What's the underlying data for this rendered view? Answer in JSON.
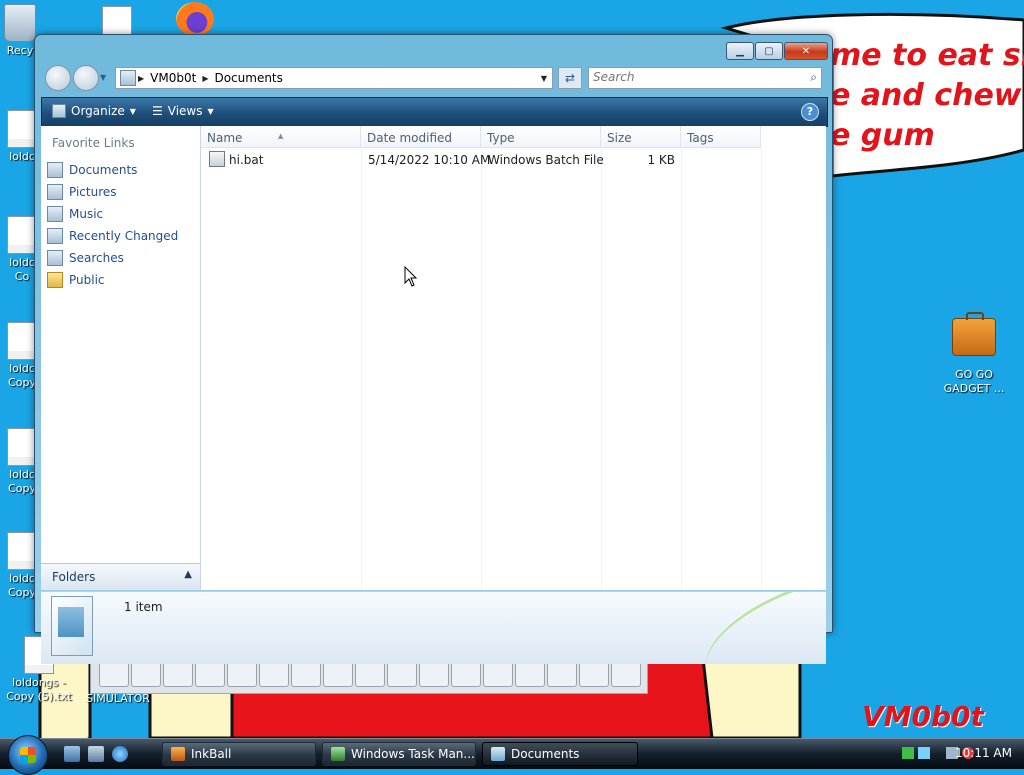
{
  "desktop": {
    "wallpaper_speech": "me to eat shit\ne and chew\ne gum",
    "wallpaper_signature": "VM0b0t",
    "icons": [
      {
        "label": "Recy",
        "icon": "recycle-bin-icon"
      },
      {
        "label": "loldc",
        "icon": "text-file-icon"
      },
      {
        "label": "loldc\nCo",
        "icon": "text-file-icon"
      },
      {
        "label": "loldc\nCopy",
        "icon": "text-file-icon"
      },
      {
        "label": "loldc\nCopy",
        "icon": "text-file-icon"
      },
      {
        "label": "loldc\nCopy",
        "icon": "text-file-icon"
      },
      {
        "label": "loldongs -\nCopy (5).txt",
        "icon": "text-file-icon"
      },
      {
        "label": "SIMULATOR",
        "icon": "app-icon"
      },
      {
        "label": "GO GO\nGADGET ...",
        "icon": "briefcase-icon"
      }
    ]
  },
  "window": {
    "title": "Documents",
    "address": {
      "crumbs": [
        "VM0b0t",
        "Documents"
      ]
    },
    "search": {
      "placeholder": "Search"
    },
    "toolbar": {
      "organize": "Organize",
      "views": "Views"
    },
    "left_pane": {
      "heading": "Favorite Links",
      "links": [
        "Documents",
        "Pictures",
        "Music",
        "Recently Changed",
        "Searches",
        "Public"
      ],
      "folders_label": "Folders"
    },
    "columns": [
      "Name",
      "Date modified",
      "Type",
      "Size",
      "Tags"
    ],
    "files": [
      {
        "name": "hi.bat",
        "date": "5/14/2022 10:10 AM",
        "type": "Windows Batch File",
        "size": "1 KB",
        "tags": ""
      }
    ],
    "details": {
      "count": "1 item"
    }
  },
  "taskbar": {
    "tasks": [
      {
        "label": "InkBall",
        "active": false
      },
      {
        "label": "Windows Task Man...",
        "active": false
      },
      {
        "label": "Documents",
        "active": true
      }
    ],
    "clock": "10:11 AM"
  },
  "colors": {
    "desktop": "#1aa6e6",
    "wallpaper_red": "#e0141a",
    "wallpaper_yellow": "#fdf6c6"
  }
}
